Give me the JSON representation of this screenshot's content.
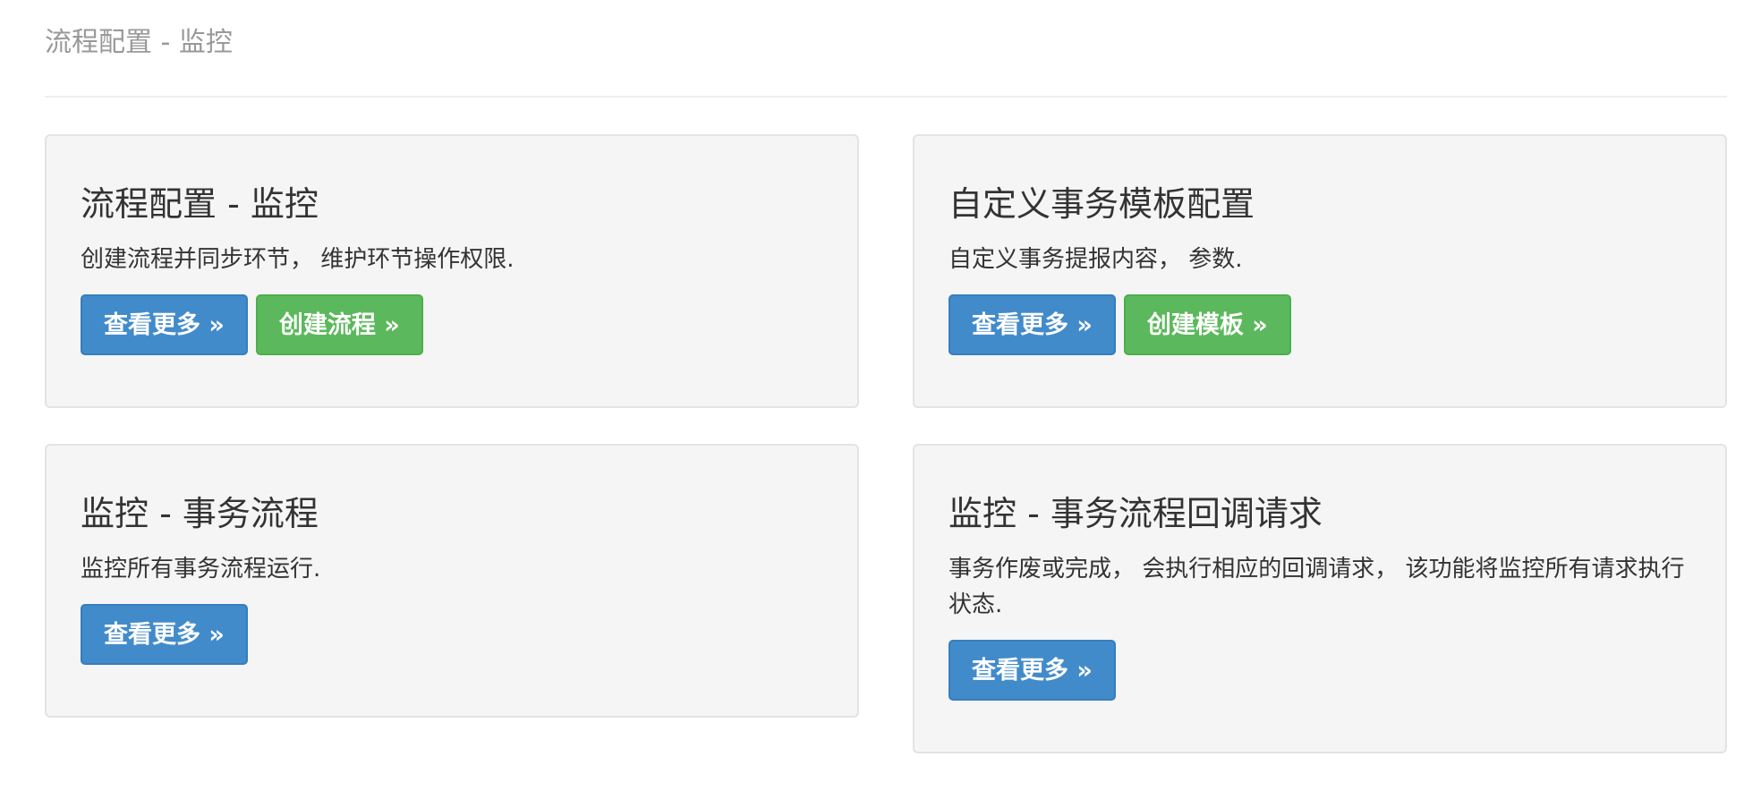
{
  "page": {
    "title": "流程配置 - 监控"
  },
  "cards": [
    {
      "title": "流程配置 - 监控",
      "description": "创建流程并同步环节， 维护环节操作权限.",
      "buttons": [
        "查看更多 »",
        "创建流程 »"
      ]
    },
    {
      "title": "自定义事务模板配置",
      "description": "自定义事务提报内容， 参数.",
      "buttons": [
        "查看更多 »",
        "创建模板 »"
      ]
    },
    {
      "title": "监控 - 事务流程",
      "description": "监控所有事务流程运行.",
      "buttons": [
        "查看更多 »"
      ]
    },
    {
      "title": "监控 - 事务流程回调请求",
      "description": "事务作废或完成， 会执行相应的回调请求， 该功能将监控所有请求执行状态.",
      "buttons": [
        "查看更多 »"
      ]
    }
  ],
  "colors": {
    "primary": "#428bca",
    "success": "#5cb85c",
    "card_background": "#f5f5f5",
    "header_text": "#999999"
  }
}
